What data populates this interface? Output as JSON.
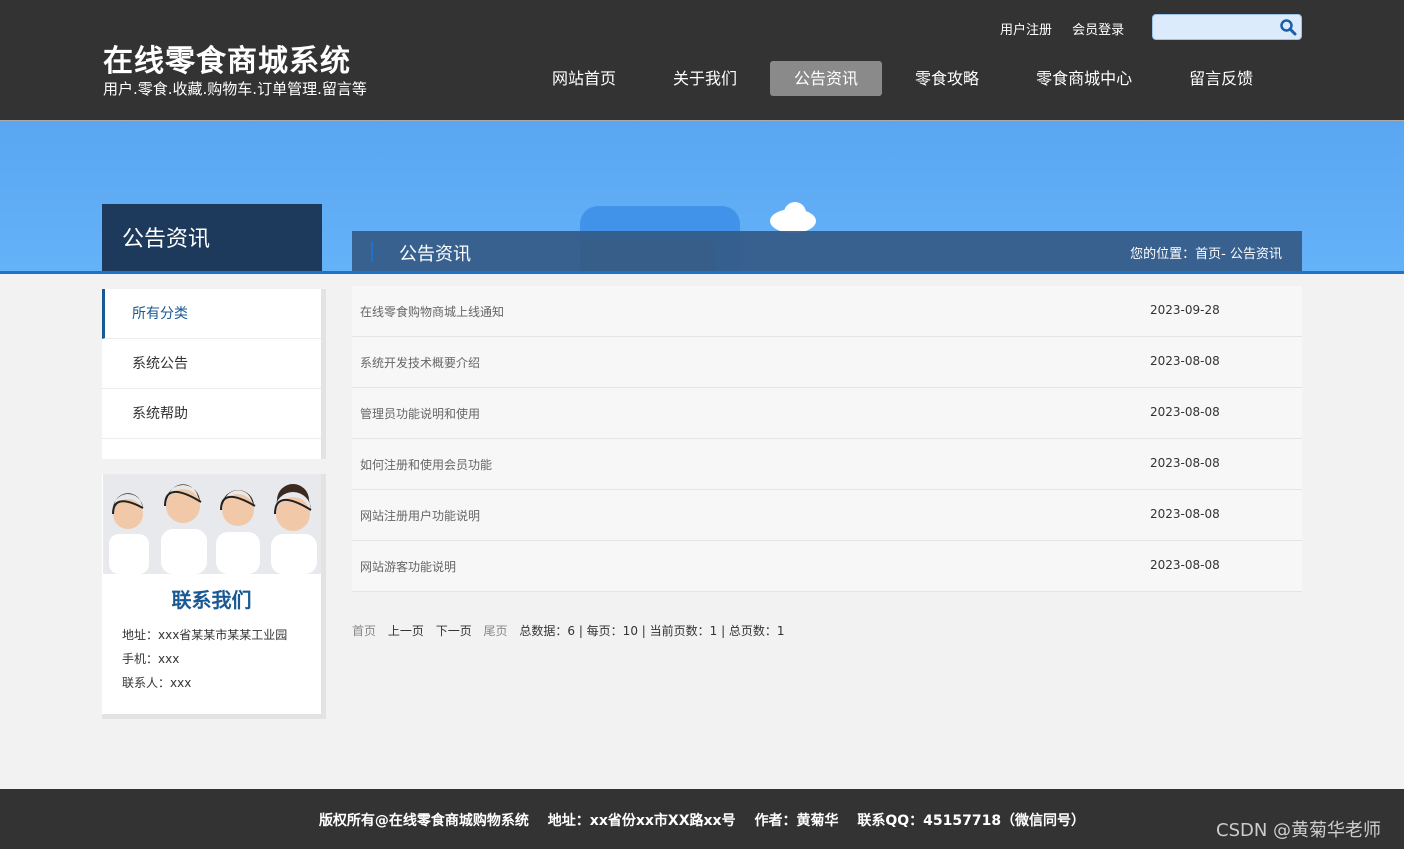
{
  "header": {
    "title": "在线零食商城系统",
    "subtitle": "用户.零食.收藏.购物车.订单管理.留言等",
    "register_link": "用户注册",
    "login_link": "会员登录",
    "search_placeholder": ""
  },
  "nav": {
    "items": [
      {
        "label": "网站首页"
      },
      {
        "label": "关于我们"
      },
      {
        "label": "公告资讯"
      },
      {
        "label": "零食攻略"
      },
      {
        "label": "零食商城中心"
      },
      {
        "label": "留言反馈"
      }
    ],
    "active_index": 2
  },
  "section": {
    "side_title": "公告资讯",
    "content_title": "公告资讯",
    "breadcrumb": "您的位置：首页- 公告资讯"
  },
  "categories": [
    {
      "label": "所有分类"
    },
    {
      "label": "系统公告"
    },
    {
      "label": "系统帮助"
    }
  ],
  "contact": {
    "title": "联系我们",
    "address": "地址：xxx省某某市某某工业园",
    "phone": "手机：xxx",
    "person": "联系人：xxx"
  },
  "notices": [
    {
      "title": "在线零食购物商城上线通知",
      "date": "2023-09-28"
    },
    {
      "title": "系统开发技术概要介绍",
      "date": "2023-08-08"
    },
    {
      "title": "管理员功能说明和使用",
      "date": "2023-08-08"
    },
    {
      "title": "如何注册和使用会员功能",
      "date": "2023-08-08"
    },
    {
      "title": "网站注册用户功能说明",
      "date": "2023-08-08"
    },
    {
      "title": "网站游客功能说明",
      "date": "2023-08-08"
    }
  ],
  "pager": {
    "first": "首页",
    "prev": "上一页",
    "next": "下一页",
    "last": "尾页",
    "summary": "总数据：6 | 每页：10 | 当前页数：1 | 总页数：1"
  },
  "footer": {
    "text": "版权所有@在线零食商城购物系统　 地址：xx省份xx市XX路xx号　 作者：黄菊华　 联系QQ：45157718（微信同号）"
  },
  "watermark": "CSDN @黄菊华老师",
  "colors": {
    "header_bg": "#333333",
    "accent": "#1a5a94",
    "banner": "#5aa6f2"
  }
}
